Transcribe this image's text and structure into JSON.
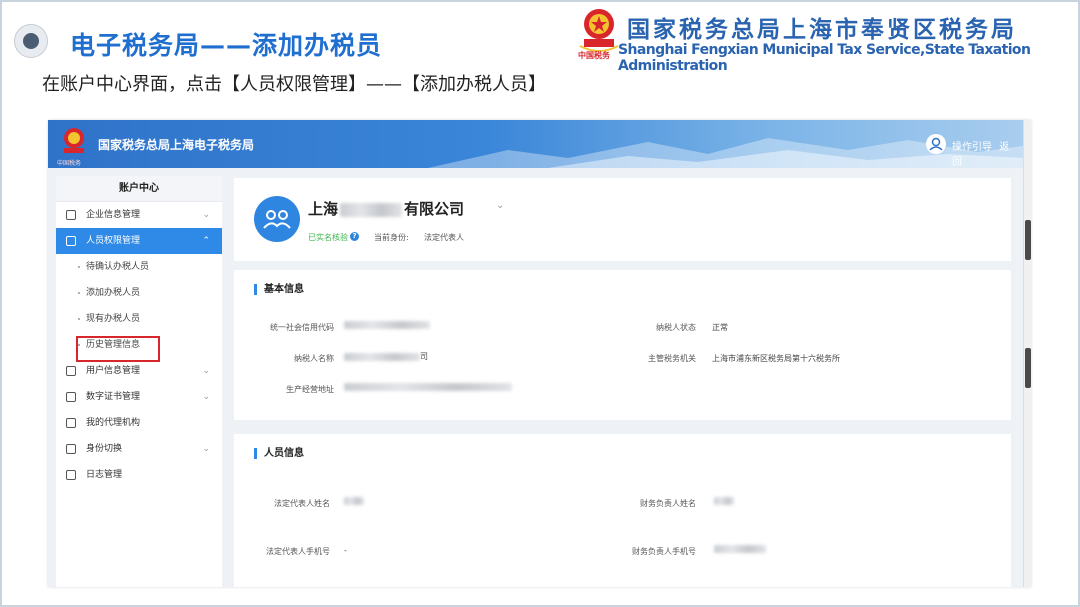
{
  "slide": {
    "title": "电子税务局——添加办税员",
    "instruction": "在账户中心界面，点击【人员权限管理】——【添加办税人员】"
  },
  "organization": {
    "name_cn": "国家税务总局上海市奉贤区税务局",
    "name_en": "Shanghai Fengxian Municipal Tax Service,State Taxation  Administration",
    "emblem_caption": "中国税务"
  },
  "app": {
    "header_title": "国家税务总局上海电子税务局",
    "header_links": [
      "操作引导",
      "返回"
    ],
    "logo_caption": "中国税务",
    "sidebar": {
      "title": "账户中心",
      "items": [
        {
          "label": "企业信息管理",
          "icon": "building-icon"
        },
        {
          "label": "人员权限管理",
          "icon": "people-lock-icon",
          "active": true
        },
        {
          "label": "待确认办税人员",
          "sub": true
        },
        {
          "label": "添加办税人员",
          "sub": true
        },
        {
          "label": "现有办税人员",
          "sub": true
        },
        {
          "label": "历史管理信息",
          "sub": true
        },
        {
          "label": "用户信息管理",
          "icon": "user-card-icon"
        },
        {
          "label": "数字证书管理",
          "icon": "certificate-icon"
        },
        {
          "label": "我的代理机构",
          "icon": "agency-icon"
        },
        {
          "label": "身份切换",
          "icon": "switch-icon"
        },
        {
          "label": "日志管理",
          "icon": "log-icon"
        }
      ]
    },
    "company": {
      "name_prefix": "上海",
      "name_suffix": "有限公司",
      "verified": "已实名核验",
      "identity_label": "当前身份:",
      "identity_value": "法定代表人"
    },
    "basic_info": {
      "title": "基本信息",
      "fields": {
        "credit_code_label": "统一社会信用代码",
        "taxpayer_name_label": "纳税人名称",
        "taxpayer_name_suffix": "司",
        "address_label": "生产经营地址",
        "status_label": "纳税人状态",
        "status_value": "正常",
        "authority_label": "主管税务机关",
        "authority_value": "上海市浦东新区税务局第十六税务所"
      }
    },
    "personnel_info": {
      "title": "人员信息",
      "fields": {
        "legal_name_label": "法定代表人姓名",
        "finance_name_label": "财务负责人姓名",
        "legal_phone_label": "法定代表人手机号",
        "legal_phone_value": "-",
        "finance_phone_label": "财务负责人手机号"
      }
    }
  },
  "colors": {
    "title_blue": "#1f6fd1",
    "org_blue": "#2a63b0",
    "active_menu": "#2e8ae6",
    "highlight_red": "#d9262c",
    "verified_green": "#3bb54a"
  }
}
